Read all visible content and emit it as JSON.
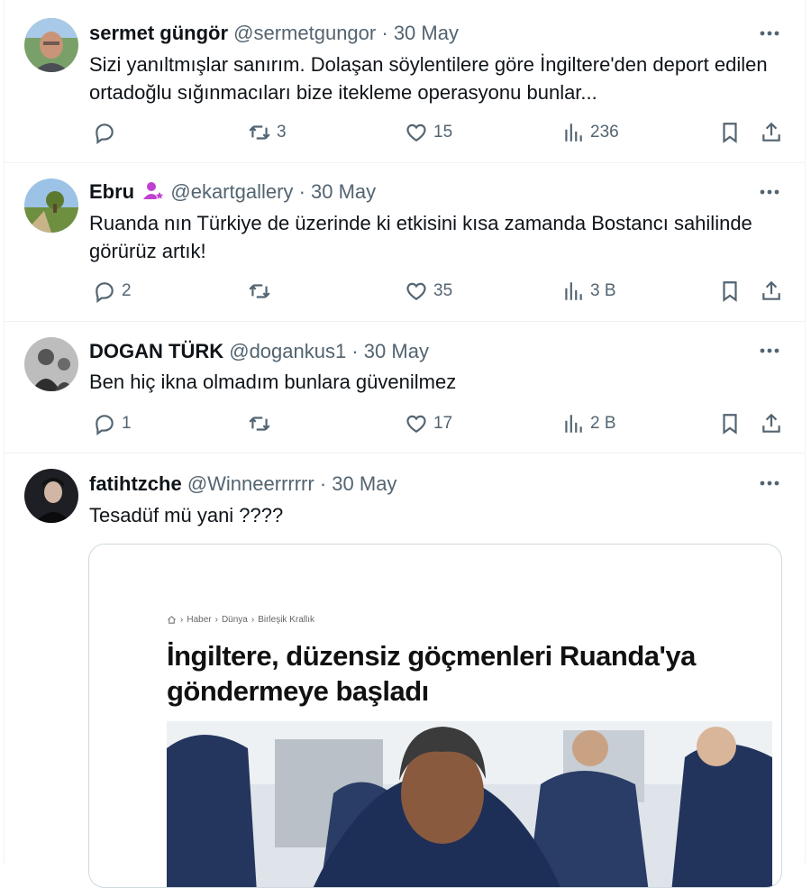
{
  "tweets": [
    {
      "name": "sermet güngör",
      "handle": "@sermetgungor",
      "date": "30 May",
      "text": "Sizi yanıltmışlar sanırım. Dolaşan söylentilere göre İngiltere'den deport edilen ortadoğlu sığınmacıları bize itekleme operasyonu bunlar...",
      "replies": "",
      "retweets": "3",
      "likes": "15",
      "views": "236"
    },
    {
      "name": "Ebru",
      "handle": "@ekartgallery",
      "date": "30 May",
      "text": "Ruanda nın Türkiye de üzerinde ki etkisini kısa zamanda Bostancı sahilinde görürüz artık!",
      "replies": "2",
      "retweets": "",
      "likes": "35",
      "views": "3 B"
    },
    {
      "name": "DOGAN TÜRK",
      "handle": "@dogankus1",
      "date": "30 May",
      "text": "Ben hiç ikna olmadım bunlara güvenilmez",
      "replies": "1",
      "retweets": "",
      "likes": "17",
      "views": "2 B"
    },
    {
      "name": "fatihtzche",
      "handle": "@Winneerrrrrr",
      "date": "30 May",
      "text": "Tesadüf mü yani  ????"
    }
  ],
  "card": {
    "breadcrumbs": [
      "Haber",
      "Dünya",
      "Birleşik Krallık"
    ],
    "headline": "İngiltere, düzensiz göçmenleri Ruanda'ya göndermeye başladı"
  },
  "separator": "·",
  "colors": {
    "text": "#0f1419",
    "muted": "#536471",
    "border": "#eff3f4",
    "badge": "#c13fd1"
  },
  "icons": [
    "more-icon",
    "reply-icon",
    "retweet-icon",
    "like-icon",
    "views-icon",
    "bookmark-icon",
    "share-icon",
    "home-icon",
    "chevron-right-icon",
    "person-badge-icon"
  ]
}
